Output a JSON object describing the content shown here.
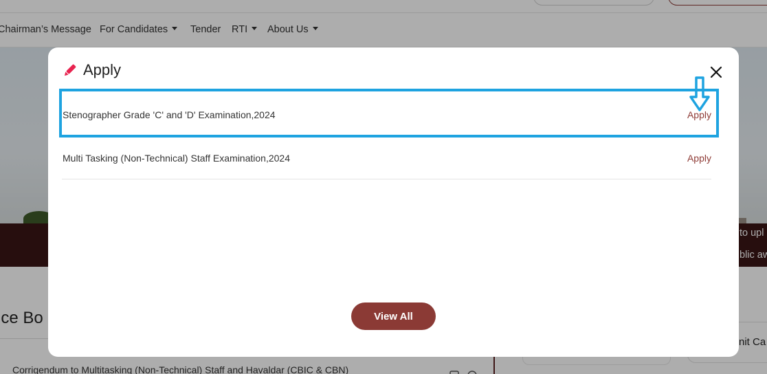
{
  "background": {
    "nav": {
      "items": [
        {
          "label": "Chairman’s Message",
          "has_caret": false
        },
        {
          "label": "For Candidates",
          "has_caret": true
        },
        {
          "label": "Tender",
          "has_caret": false
        },
        {
          "label": "RTI",
          "has_caret": true
        },
        {
          "label": "About Us",
          "has_caret": true
        }
      ]
    },
    "banner": {
      "text_line_1": "to upl",
      "text_line_2": "blic aw"
    },
    "section_title": "ice Bo",
    "notice_link": "Corrigendum to Multitasking (Non-Technical) Staff and Havaldar (CBIC & CBN)",
    "right_card_text": "nit Ca"
  },
  "modal": {
    "title": "Apply",
    "pencil_icon": "pencil-icon",
    "close_icon": "close-icon",
    "items": [
      {
        "name": "Stenographer Grade 'C' and 'D' Examination,2024",
        "action": "Apply"
      },
      {
        "name": "Multi Tasking (Non-Technical) Staff Examination,2024",
        "action": "Apply"
      }
    ],
    "view_all_label": "View All"
  },
  "annotation": {
    "highlight_color": "#1ea3e0",
    "arrow_icon": "arrow-down-outline-icon"
  },
  "colors": {
    "brand": "#8b3a35",
    "accent_pencil": "#e8234f",
    "banner_bg": "#3a1616"
  }
}
